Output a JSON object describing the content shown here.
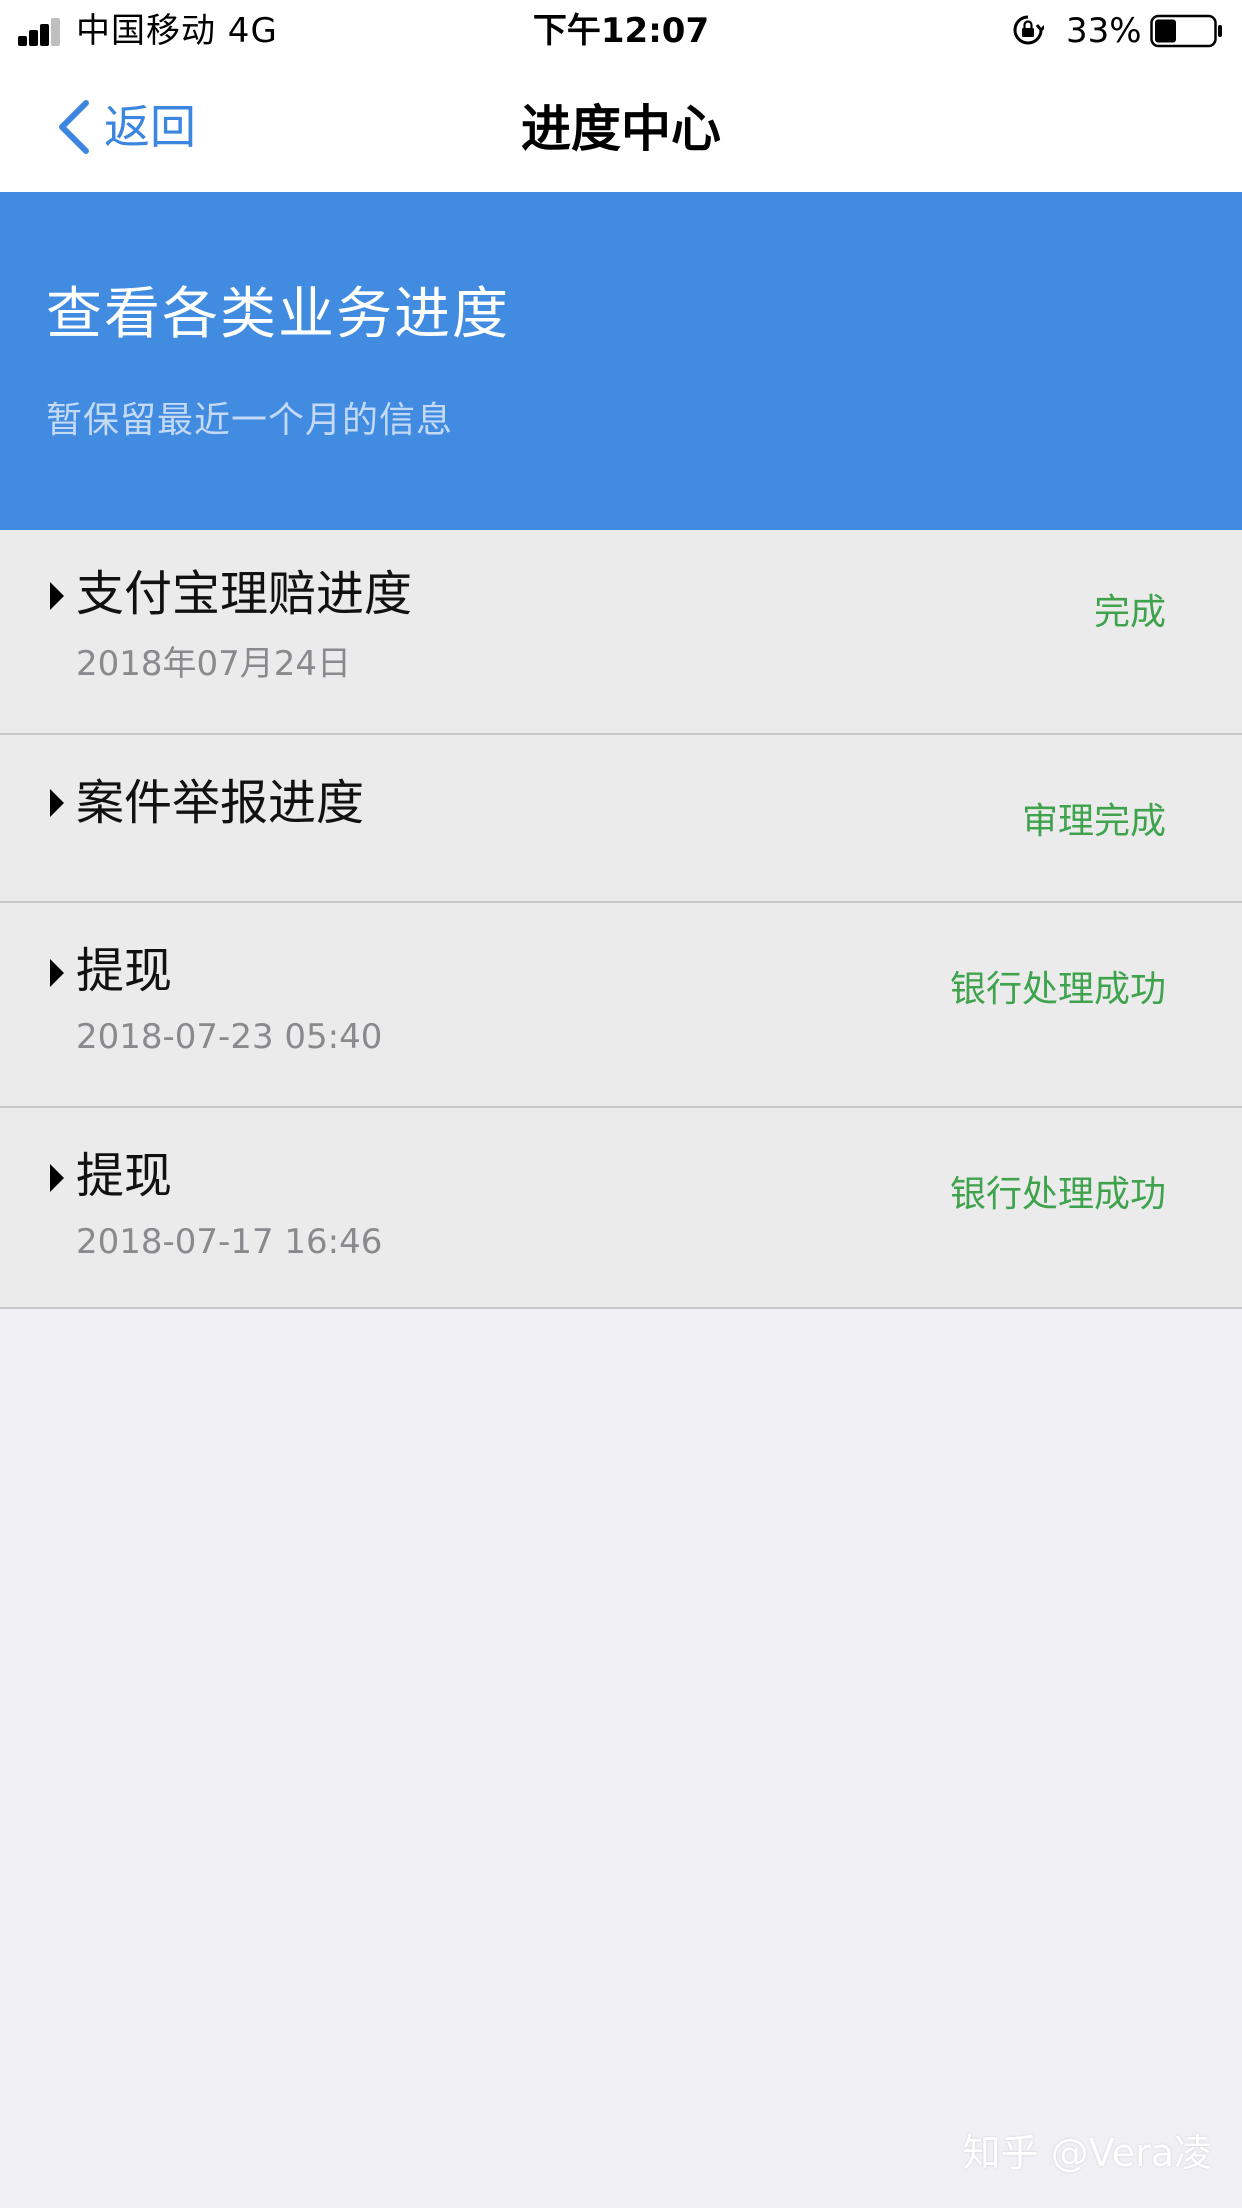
{
  "status_bar": {
    "carrier": "中国移动  4G",
    "time": "下午12:07",
    "battery_percent": "33%",
    "battery_level": 0.33,
    "icons": [
      "signal-icon",
      "orientation-lock-icon",
      "battery-icon"
    ]
  },
  "nav": {
    "back_label": "返回",
    "title": "进度中心"
  },
  "hero": {
    "title": "查看各类业务进度",
    "subtitle": "暂保留最近一个月的信息"
  },
  "list": {
    "items": [
      {
        "title": "支付宝理赔进度",
        "date": "2018年07月24日",
        "status": "完成"
      },
      {
        "title": "案件举报进度",
        "date": "",
        "status": "审理完成"
      },
      {
        "title": "提现",
        "date": "2018-07-23 05:40",
        "status": "银行处理成功"
      },
      {
        "title": "提现",
        "date": "2018-07-17 16:46",
        "status": "银行处理成功"
      }
    ]
  },
  "watermark": "知乎 @Vera凌",
  "colors": {
    "accent_blue": "#418be1",
    "link_blue": "#3d86e0",
    "status_green": "#3ea34c",
    "page_bg": "#efeff4",
    "row_bg": "#ebebeb"
  }
}
